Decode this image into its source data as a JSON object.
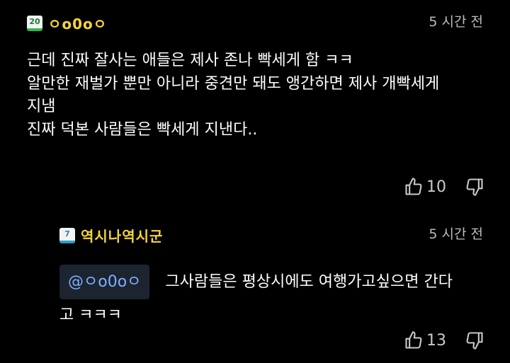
{
  "comments": [
    {
      "badge": "20",
      "author": "ㅇo0oㅇ",
      "time": "5 시간 전",
      "lines": [
        "근데 진짜 잘사는 애들은 제사 존나 빡세게 함 ㅋㅋ",
        "알만한 재벌가 뿐만 아니라 중견만 돼도 앵간하면 제사 개빡세게",
        "지냄",
        "진짜 덕본 사람들은 빡세게 지낸다.."
      ],
      "likes": "10",
      "icons": {
        "like": "thumbs-up-icon",
        "dislike": "thumbs-down-icon"
      }
    },
    {
      "badge": "7",
      "author": "역시나역시군",
      "time": "5 시간 전",
      "mention": "@ㅇo0oㅇ",
      "text_first": "그사람들은 평상시에도 여행가고싶으면 간다",
      "text_second": "고 ㅋㅋㅋ",
      "likes": "13",
      "icons": {
        "like": "thumbs-up-icon",
        "dislike": "thumbs-down-icon"
      }
    }
  ],
  "colors": {
    "background": "#000000",
    "author": "#f5d53a",
    "mention": "#7eb0ff",
    "muted": "#bdbdbd"
  }
}
